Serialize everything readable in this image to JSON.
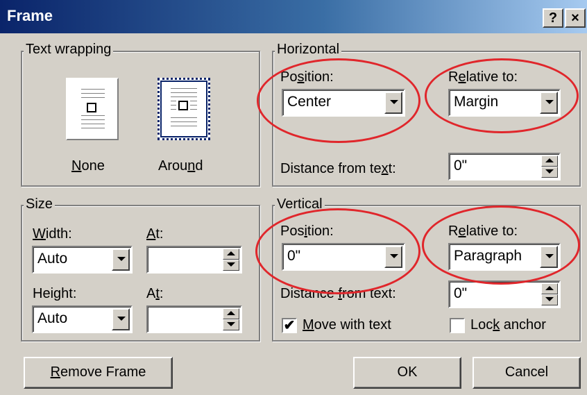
{
  "window": {
    "title": "Frame",
    "help_glyph": "?",
    "close_glyph": "×"
  },
  "text_wrapping": {
    "label": "Text wrapping",
    "options": [
      {
        "pre": "",
        "acc": "N",
        "post": "one"
      },
      {
        "pre": "Arou",
        "acc": "n",
        "post": "d"
      }
    ]
  },
  "size": {
    "label": "Size",
    "width": {
      "pre": "",
      "acc": "W",
      "post": "idth:",
      "value": "Auto"
    },
    "width_at": {
      "pre": "",
      "acc": "A",
      "post": "t:",
      "value": ""
    },
    "height": {
      "pre": "Hei",
      "acc": "g",
      "post": "ht:",
      "value": "Auto"
    },
    "height_at": {
      "pre": "A",
      "acc": "t",
      "post": ":",
      "value": ""
    }
  },
  "horizontal": {
    "label": "Horizontal",
    "position": {
      "pre": "Po",
      "acc": "s",
      "post": "ition:",
      "value": "Center"
    },
    "relative": {
      "pre": "R",
      "acc": "e",
      "post": "lative to:",
      "value": "Margin"
    },
    "distance": {
      "pre": "Distance from te",
      "acc": "x",
      "post": "t:",
      "value": "0\""
    }
  },
  "vertical": {
    "label": "Vertical",
    "position": {
      "pre": "Pos",
      "acc": "i",
      "post": "tion:",
      "value": "0\""
    },
    "relative": {
      "pre": "R",
      "acc": "e",
      "post": "lative to:",
      "value": "Paragraph"
    },
    "distance": {
      "pre": "Distance ",
      "acc": "f",
      "post": "rom text:",
      "value": "0\""
    },
    "move_with_text": {
      "pre": "",
      "acc": "M",
      "post": "ove with text",
      "checked_glyph": "✔"
    },
    "lock_anchor": {
      "pre": "Loc",
      "acc": "k",
      "post": " anchor",
      "checked_glyph": ""
    }
  },
  "buttons": {
    "remove": {
      "pre": "",
      "acc": "R",
      "post": "emove Frame"
    },
    "ok": "OK",
    "cancel": "Cancel"
  },
  "annotation": {
    "color": "#e0262b"
  }
}
